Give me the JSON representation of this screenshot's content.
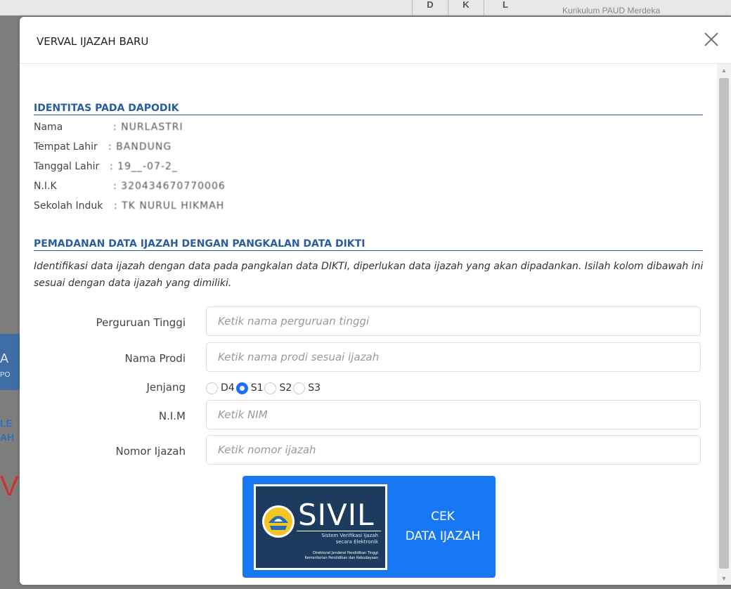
{
  "background": {
    "top_cells": [
      "D",
      "K",
      "L"
    ],
    "top_right_text": "Kurikulum PAUD Merdeka",
    "left_fragments": [
      "A",
      "PO",
      "LE",
      "AH",
      "V"
    ]
  },
  "modal": {
    "title": "VERVAL IJAZAH BARU",
    "close_icon": "close-icon"
  },
  "identitas": {
    "section_title": "IDENTITAS PADA DAPODIK",
    "fields": [
      {
        "label": "Nama",
        "value": ": NURLASTRI"
      },
      {
        "label": "Tempat Lahir",
        "value": ": BANDUNG"
      },
      {
        "label": "Tanggal Lahir",
        "value": ": 19__-07-2_"
      },
      {
        "label": "N.I.K",
        "value": ": 320434670770006"
      },
      {
        "label": "Sekolah Induk",
        "value": ": TK NURUL HIKMAH"
      }
    ]
  },
  "pemadanan": {
    "section_title": "PEMADANAN DATA IJAZAH DENGAN PANGKALAN DATA DIKTI",
    "description": "Identifikasi data ijazah dengan data pada pangkalan data DIKTI, diperlukan data ijazah yang akan dipadankan. Isilah kolom dibawah ini sesuai dengan data ijazah yang dimiliki."
  },
  "form": {
    "perguruan_tinggi": {
      "label": "Perguruan Tinggi",
      "placeholder": "Ketik nama perguruan tinggi",
      "value": ""
    },
    "nama_prodi": {
      "label": "Nama Prodi",
      "placeholder": "Ketik nama prodi sesuai ijazah",
      "value": ""
    },
    "jenjang": {
      "label": "Jenjang",
      "options": [
        "D4",
        "S1",
        "S2",
        "S3"
      ],
      "selected": "S1"
    },
    "nim": {
      "label": "N.I.M",
      "placeholder": "Ketik NIM",
      "value": ""
    },
    "nomor_ijazah": {
      "label": "Nomor Ijazah",
      "placeholder": "Ketik nomor ijazah",
      "value": ""
    }
  },
  "cek_button": {
    "line1": "CEK",
    "line2": "DATA IJAZAH",
    "logo": {
      "word": "SIVIL",
      "subtitle_1": "Sistem Verifikasi Ijazah",
      "subtitle_2": "secara Elektronik",
      "footer_1": "Direktorat Jenderal Pendidikan Tinggi",
      "footer_2": "Kementerian Pendidikan dan Kebudayaan"
    }
  },
  "colors": {
    "accent": "#1877f2",
    "section_title": "#2a5d9f",
    "radio_checked": "#1a73e8"
  }
}
